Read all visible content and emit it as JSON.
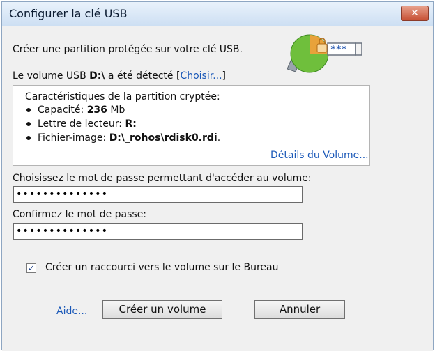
{
  "window": {
    "title": "Configurer la clé USB",
    "close_symbol": "✕"
  },
  "intro_text": "Créer une partition protégée sur votre clé USB.",
  "detected": {
    "prefix": "Le volume USB ",
    "drive": "D:\\",
    "suffix": " a été détecté [",
    "choose_link": "Choisir...",
    "close_bracket": "]"
  },
  "partition": {
    "title": "Caractéristiques de la partition cryptée:",
    "capacity_label": "Capacité: ",
    "capacity_value": "236",
    "capacity_unit": " Mb",
    "drive_letter_label": "Lettre de lecteur: ",
    "drive_letter_value": "R:",
    "image_file_label": "Fichier-image: ",
    "image_file_value": "D:\\_rohos\\rdisk0.rdi",
    "image_file_suffix": ".",
    "details_link": "Détails du Volume..."
  },
  "password": {
    "label": "Choisissez le mot de passe permettant d'accéder au volume:",
    "value": "••••••••••••••"
  },
  "confirm": {
    "label": "Confirmez le mot de passe:",
    "value": "••••••••••••••"
  },
  "shortcut": {
    "checked": true,
    "check_symbol": "✓",
    "label": "Créer un raccourci vers le volume sur le Bureau"
  },
  "buttons": {
    "help": "Aide...",
    "create": "Créer un volume",
    "cancel": "Annuler"
  },
  "icon": {
    "name": "usb-lock-icon",
    "password_glyph": "***"
  },
  "colors": {
    "link": "#1a58b8",
    "close_button": "#c75034",
    "title_bar": "#cddff3"
  }
}
